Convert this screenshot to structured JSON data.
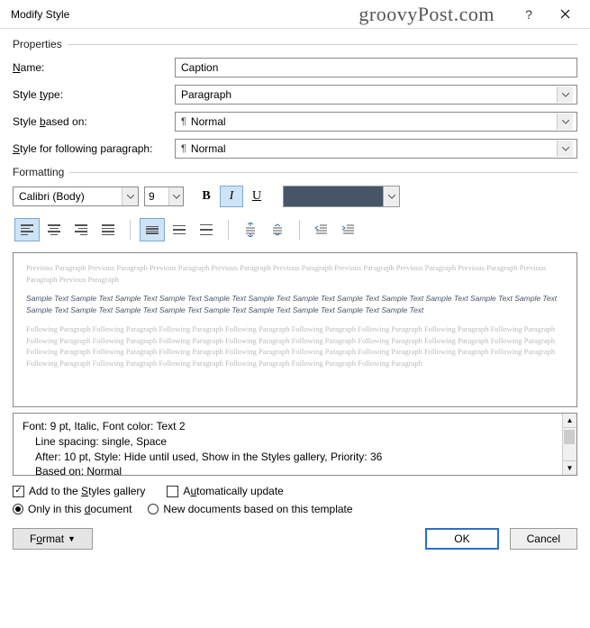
{
  "titlebar": {
    "title": "Modify Style",
    "watermark": "groovyPost.com"
  },
  "properties": {
    "legend": "Properties",
    "name_label_pre": "",
    "name_hot": "N",
    "name_label_post": "ame:",
    "name_value": "Caption",
    "type_label_pre": "Style ",
    "type_hot": "t",
    "type_label_post": "ype:",
    "type_value": "Paragraph",
    "based_label_pre": "Style ",
    "based_hot": "b",
    "based_label_post": "ased on:",
    "based_value": "Normal",
    "follow_label_pre": "",
    "follow_hot": "S",
    "follow_label_post": "tyle for following paragraph:",
    "follow_value": "Normal"
  },
  "formatting": {
    "legend": "Formatting",
    "font": "Calibri (Body)",
    "size": "9",
    "color": "#475569"
  },
  "preview": {
    "prev": "Previous Paragraph Previous Paragraph Previous Paragraph Previous Paragraph Previous Paragraph Previous Paragraph Previous Paragraph Previous Paragraph Previous Paragraph Previous Paragraph",
    "sample": "Sample Text Sample Text Sample Text Sample Text Sample Text Sample Text Sample Text Sample Text Sample Text Sample Text Sample Text Sample Text Sample Text Sample Text Sample Text Sample Text Sample Text Sample Text Sample Text Sample Text Sample Text",
    "foll": "Following Paragraph Following Paragraph Following Paragraph Following Paragraph Following Paragraph Following Paragraph Following Paragraph Following Paragraph Following Paragraph Following Paragraph Following Paragraph Following Paragraph Following Paragraph Following Paragraph Following Paragraph Following Paragraph Following Paragraph Following Paragraph Following Paragraph Following Paragraph Following Paragraph Following Paragraph Following Paragraph Following Paragraph Following Paragraph Following Paragraph Following Paragraph Following Paragraph Following Paragraph Following Paragraph"
  },
  "description": {
    "line1": "Font: 9 pt, Italic, Font color: Text 2",
    "line2": "Line spacing:  single, Space",
    "line3": "After:  10 pt, Style: Hide until used, Show in the Styles gallery, Priority: 36",
    "line4": "Based on: Normal"
  },
  "checks": {
    "gallery_pre": "Add to the ",
    "gallery_hot": "S",
    "gallery_post": "tyles gallery",
    "auto_pre": "A",
    "auto_hot": "u",
    "auto_post": "tomatically update"
  },
  "radios": {
    "doc_pre": "Only in this ",
    "doc_hot": "d",
    "doc_post": "ocument",
    "tpl": "New documents based on this template"
  },
  "buttons": {
    "format_pre": "F",
    "format_hot": "o",
    "format_post": "rmat",
    "ok": "OK",
    "cancel": "Cancel"
  }
}
